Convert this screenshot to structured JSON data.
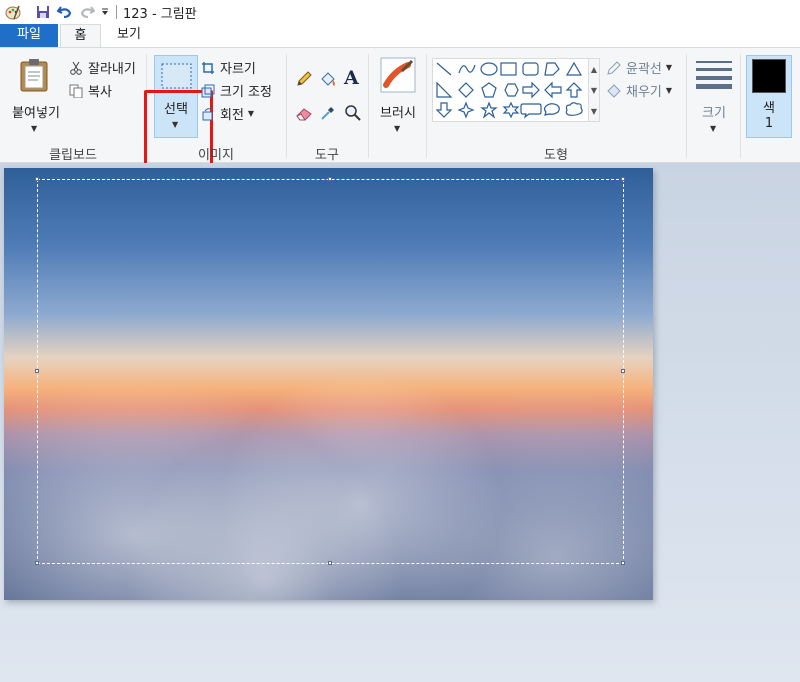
{
  "window": {
    "title": "123 - 그림판"
  },
  "quick_access": {
    "icons": [
      "paint-app-icon",
      "save-icon",
      "undo-icon",
      "redo-icon",
      "customize-dropdown-icon"
    ]
  },
  "tabs": {
    "file": "파일",
    "home": "홈",
    "view": "보기"
  },
  "ribbon": {
    "clipboard": {
      "paste": "붙여넣기",
      "cut": "잘라내기",
      "copy": "복사",
      "group_label": "클립보드"
    },
    "image": {
      "select": "선택",
      "crop": "자르기",
      "resize": "크기 조정",
      "rotate": "회전",
      "group_label": "이미지"
    },
    "tools": {
      "group_label": "도구"
    },
    "brushes": {
      "label": "브러시"
    },
    "shapes": {
      "outline": "윤곽선",
      "fill": "채우기",
      "group_label": "도형"
    },
    "size": {
      "label": "크기"
    },
    "color": {
      "label": "색",
      "sub_label": "1",
      "value": "#000000"
    }
  },
  "colors": {
    "accent": "#1f6ec8",
    "selected_bg": "#cce4f7",
    "highlight": "#e81515"
  }
}
